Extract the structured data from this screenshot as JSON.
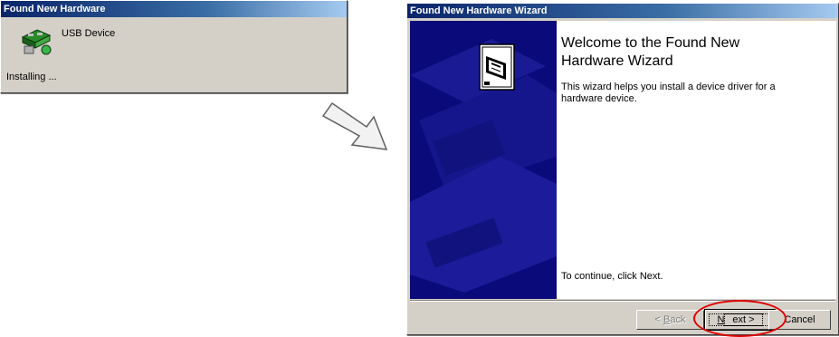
{
  "popup": {
    "title": "Found New Hardware",
    "device_label": "USB Device",
    "status": "Installing ..."
  },
  "wizard": {
    "title": "Found New Hardware Wizard",
    "heading_line1": "Welcome to the Found New",
    "heading_line2": "Hardware Wizard",
    "desc_line1": "This wizard helps you install a device driver for a",
    "desc_line2": "hardware device.",
    "continue_text": "To continue, click Next.",
    "back_prefix": "< ",
    "back_accel": "B",
    "back_rest": "ack",
    "next_accel": "N",
    "next_rest": "ext >",
    "cancel_label": "Cancel"
  },
  "colors": {
    "titlebar_start": "#0a246a",
    "titlebar_end": "#a6caf0",
    "side_panel": "#0a0a7a",
    "highlight_ring": "#e00000",
    "dialog_face": "#d4d0c8"
  },
  "icons": {
    "popup_device": "hardware-device-icon",
    "wizard_device": "hardware-card-icon",
    "transition_arrow": "arrow-right-down-icon"
  }
}
